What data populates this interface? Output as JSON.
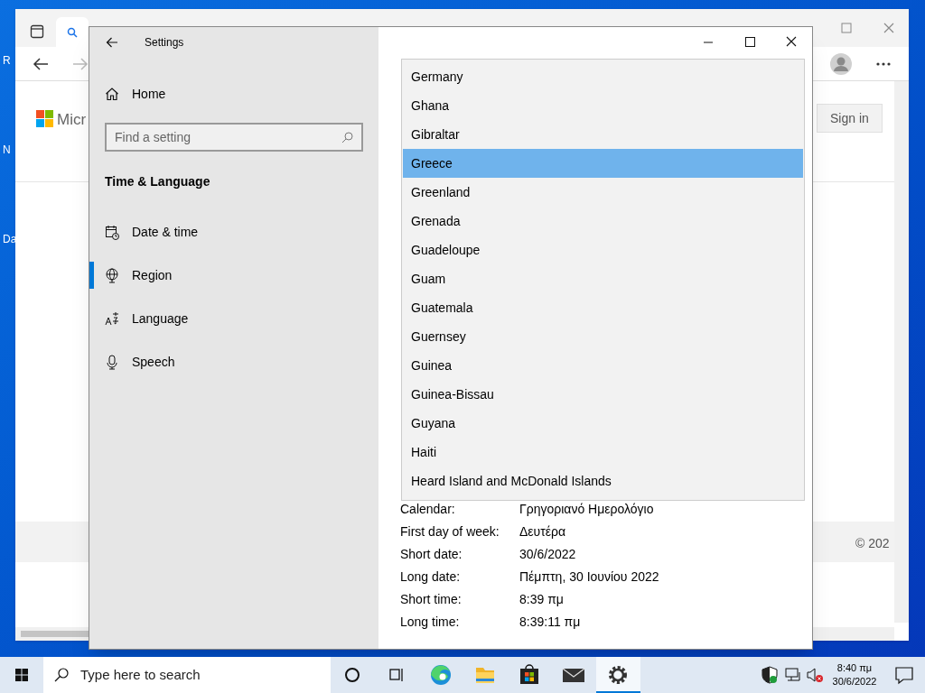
{
  "desktop_icons": [
    {
      "label": "R"
    },
    {
      "label": "N"
    },
    {
      "label": "Da"
    }
  ],
  "browser": {
    "logo_text": "Micr",
    "sign_in": "Sign in",
    "footer": "© 202"
  },
  "settings": {
    "title": "Settings",
    "home": "Home",
    "search_placeholder": "Find a setting",
    "section": "Time & Language",
    "nav": [
      {
        "label": "Date & time",
        "kind": "calendar",
        "selected": false
      },
      {
        "label": "Region",
        "kind": "globe",
        "selected": true
      },
      {
        "label": "Language",
        "kind": "language",
        "selected": false
      },
      {
        "label": "Speech",
        "kind": "mic",
        "selected": false
      }
    ],
    "countries": [
      {
        "name": "Germany",
        "selected": false
      },
      {
        "name": "Ghana",
        "selected": false
      },
      {
        "name": "Gibraltar",
        "selected": false
      },
      {
        "name": "Greece",
        "selected": true
      },
      {
        "name": "Greenland",
        "selected": false
      },
      {
        "name": "Grenada",
        "selected": false
      },
      {
        "name": "Guadeloupe",
        "selected": false
      },
      {
        "name": "Guam",
        "selected": false
      },
      {
        "name": "Guatemala",
        "selected": false
      },
      {
        "name": "Guernsey",
        "selected": false
      },
      {
        "name": "Guinea",
        "selected": false
      },
      {
        "name": "Guinea-Bissau",
        "selected": false
      },
      {
        "name": "Guyana",
        "selected": false
      },
      {
        "name": "Haiti",
        "selected": false
      },
      {
        "name": "Heard Island and McDonald Islands",
        "selected": false
      }
    ],
    "formats": [
      {
        "label": "Calendar:",
        "value": "Γρηγοριανό Ημερολόγιο"
      },
      {
        "label": "First day of week:",
        "value": "Δευτέρα"
      },
      {
        "label": "Short date:",
        "value": "30/6/2022"
      },
      {
        "label": "Long date:",
        "value": "Πέμπτη, 30 Ιουνίου 2022"
      },
      {
        "label": "Short time:",
        "value": "8:39 πμ"
      },
      {
        "label": "Long time:",
        "value": "8:39:11 πμ"
      }
    ]
  },
  "taskbar": {
    "search_placeholder": "Type here to search",
    "apps": [
      {
        "kind": "cortana",
        "active": false
      },
      {
        "kind": "taskview",
        "active": false
      },
      {
        "kind": "edge",
        "active": false
      },
      {
        "kind": "explorer",
        "active": false
      },
      {
        "kind": "store",
        "active": false
      },
      {
        "kind": "mail",
        "active": false
      },
      {
        "kind": "settings",
        "active": true
      }
    ],
    "time": "8:40 πμ",
    "date": "30/6/2022"
  }
}
